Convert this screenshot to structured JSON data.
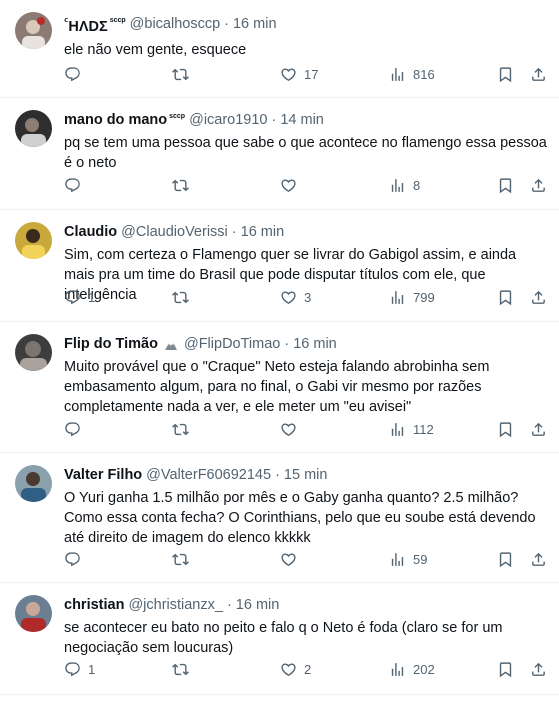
{
  "tweets": [
    {
      "name": "ΗΛDΣ",
      "name_prefix": "ᑦ",
      "badge": "sccp",
      "handle": "@bicalhosccp",
      "time": "16 min",
      "text": "ele não vem gente, esquece",
      "replies": "",
      "retweets": "",
      "likes": "17",
      "views": "816",
      "avatar_color": "#7a6a64"
    },
    {
      "name": "mano do mano",
      "badge": "sccp",
      "handle": "@icaro1910",
      "time": "14 min",
      "text": "pq se tem uma pessoa que sabe o que acontece no flamengo essa pessoa é o neto",
      "replies": "",
      "retweets": "",
      "likes": "",
      "views": "8",
      "avatar_color": "#3b3b3b"
    },
    {
      "name": "Claudio",
      "badge": "",
      "handle": "@ClaudioVerissi",
      "time": "16 min",
      "text": "Sim, com certeza o Flamengo quer se livrar do Gabigol assim, e ainda mais pra um time do Brasil que pode disputar títulos com ele, que inteligência",
      "replies": "1",
      "retweets": "",
      "likes": "3",
      "views": "799",
      "avatar_color": "#d4b54a"
    },
    {
      "name": "Flip do Timão",
      "badge": "",
      "handle": "@FlipDoTimao",
      "time": "16 min",
      "text": "Muito provável que o \"Craque\" Neto esteja falando abrobinha sem embasamento algum, para no final, o Gabi vir mesmo por razões completamente nada a ver, e ele meter um \"eu avisei\"",
      "replies": "",
      "retweets": "",
      "likes": "",
      "views": "112",
      "avatar_color": "#4a4a4a"
    },
    {
      "name": "Valter Filho",
      "badge": "",
      "handle": "@ValterF60692145",
      "time": "15 min",
      "text": "O Yuri ganha 1.5 milhão por mês e o Gaby ganha quanto? 2.5 milhão? Como essa conta fecha? O Corinthians, pelo que eu soube está devendo até direito de imagem do elenco kkkkk",
      "replies": "",
      "retweets": "",
      "likes": "",
      "views": "59",
      "avatar_color": "#6f7f8c"
    },
    {
      "name": "christian",
      "badge": "",
      "handle": "@jchristianzx_",
      "time": "16 min",
      "text": "se acontecer eu bato no peito e falo q o Neto é foda (claro se for um negociação sem loucuras)",
      "replies": "1",
      "retweets": "",
      "likes": "2",
      "views": "202",
      "avatar_color": "#5a6f86"
    }
  ]
}
